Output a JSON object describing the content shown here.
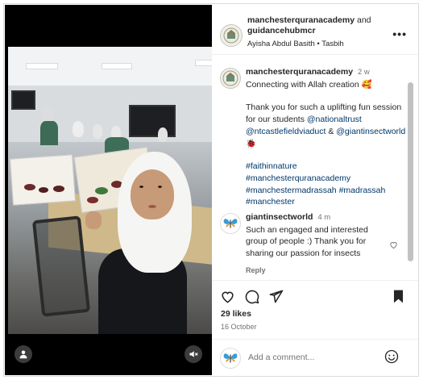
{
  "post": {
    "author": "manchesterquranacademy",
    "connector": "and",
    "collaborator": "guidancehubmcr",
    "audio": "Ayisha Abdul Basith • Tasbih",
    "more_icon": "more-horizontal-icon"
  },
  "caption": {
    "author": "manchesterquranacademy",
    "time": "2 w",
    "line1": "Connecting with Allah creation",
    "line1_emoji": "🥰",
    "line2_prefix": "Thank you for such a uplifting fun session for our students",
    "mention1": "@nationaltrust",
    "mention2": "@ntcastlefieldviaduct",
    "amp": "&",
    "mention3": "@giantinsectworld",
    "line2_emoji": "🐞",
    "tag1": "#faithinnature",
    "tag2": "#manchesterquranacademy",
    "tag3": "#manchestermadrassah",
    "tag4": "#madrassah",
    "tag5": "#manchester"
  },
  "comment": {
    "author": "giantinsectworld",
    "time": "4 m",
    "text": "Such an engaged and interested group of people :) Thank you for sharing our passion for insects",
    "reply": "Reply"
  },
  "engagement": {
    "likes": "29 likes",
    "date": "16 October"
  },
  "composer": {
    "placeholder": "Add a comment..."
  },
  "colors": {
    "link": "#00376b",
    "text": "#262626",
    "muted": "#737373"
  }
}
